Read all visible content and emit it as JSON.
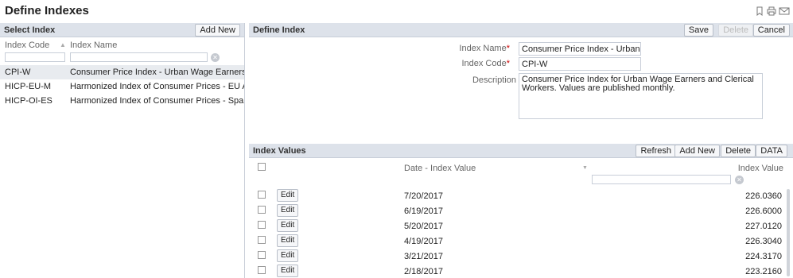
{
  "page": {
    "title": "Define Indexes"
  },
  "top_icons": [
    "bookmark-icon",
    "print-icon",
    "mail-icon"
  ],
  "select_index": {
    "title": "Select Index",
    "add_new": "Add New",
    "columns": {
      "code": "Index Code",
      "name": "Index Name"
    },
    "rows": [
      {
        "code": "CPI-W",
        "name": "Consumer Price Index - Urban Wage Earners",
        "selected": true
      },
      {
        "code": "HICP-EU-M",
        "name": "Harmonized Index of Consumer Prices - EU Avera"
      },
      {
        "code": "HICP-OI-ES",
        "name": "Harmonized Index of Consumer Prices - Spain"
      }
    ]
  },
  "define_index": {
    "title": "Define Index",
    "buttons": {
      "save": "Save",
      "delete": "Delete",
      "cancel": "Cancel"
    },
    "name_label": "Index Name",
    "name_value": "Consumer Price Index - Urban Wa",
    "code_label": "Index Code",
    "code_value": "CPI-W",
    "desc_label": "Description",
    "desc_value": "Consumer Price Index for Urban Wage Earners and Clerical Workers. Values are published monthly."
  },
  "index_values": {
    "title": "Index Values",
    "buttons": {
      "refresh": "Refresh",
      "add_new": "Add New",
      "delete": "Delete",
      "data": "DATA"
    },
    "columns": {
      "date": "Date - Index Value",
      "value": "Index Value"
    },
    "edit_label": "Edit",
    "rows": [
      {
        "date": "7/20/2017",
        "value": "226.0360"
      },
      {
        "date": "6/19/2017",
        "value": "226.6000"
      },
      {
        "date": "5/20/2017",
        "value": "227.0120"
      },
      {
        "date": "4/19/2017",
        "value": "226.3040"
      },
      {
        "date": "3/21/2017",
        "value": "224.3170"
      },
      {
        "date": "2/18/2017",
        "value": "223.2160"
      }
    ]
  },
  "colors": {
    "header_bg": "#dde2ea",
    "selected_row": "#e8ebef",
    "required": "#cc0000"
  }
}
